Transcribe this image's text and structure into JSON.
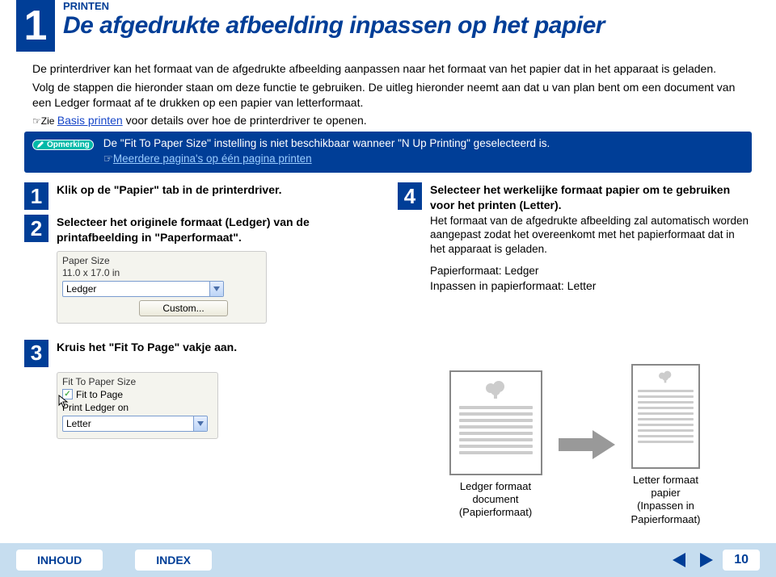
{
  "header": {
    "sectionNumber": "1",
    "printen": "PRINTEN",
    "title": "De afgedrukte afbeelding inpassen op het papier"
  },
  "intro": "De printerdriver kan het formaat van de afgedrukte afbeelding aanpassen naar het formaat van het papier dat in het apparaat is geladen.",
  "intro2": "Volg de stappen die hieronder staan om deze functie te gebruiken. De uitleg hieronder neemt aan dat u van plan bent om een document van een Ledger formaat af te drukken op een papier van letterformaat.",
  "seePrefix": "☞Zie ",
  "seeLink": "Basis printen",
  "seeSuffix": " voor details over hoe de printerdriver te openen.",
  "note": {
    "pill": "Opmerking",
    "line1": "De \"Fit To Paper Size\" instelling is niet beschikbaar wanneer \"N Up Printing\" geselecteerd is.",
    "linkPrefix": "☞",
    "link": "Meerdere pagina's op één pagina printen"
  },
  "steps": {
    "s1": {
      "num": "1",
      "title": "Klik op de \"Papier\" tab in de printerdriver."
    },
    "s2": {
      "num": "2",
      "title": "Selecteer het originele formaat (Ledger) van de printafbeelding in \"Paperformaat\"."
    },
    "s3": {
      "num": "3",
      "title": "Kruis het \"Fit To Page\" vakje aan."
    },
    "s4": {
      "num": "4",
      "title": "Selecteer het werkelijke formaat papier om te gebruiken voor het printen (Letter).",
      "sub": "Het formaat van de afgedrukte afbeelding zal automatisch worden aangepast zodat het overeenkomt met het papierformaat dat in het apparaat is geladen.",
      "extra1": "Papierformaat: Ledger",
      "extra2": "Inpassen in papierformaat: Letter"
    }
  },
  "paperSize": {
    "label": "Paper Size",
    "dims": "11.0 x 17.0 in",
    "value": "Ledger",
    "customBtn": "Custom..."
  },
  "fitToPage": {
    "label": "Fit To Paper Size",
    "checkbox": "Fit to Page",
    "printOn": "Print Ledger on",
    "value": "Letter"
  },
  "illus": {
    "left1": "Ledger formaat",
    "left2": "document",
    "left3": "(Papierformaat)",
    "right1": "Letter formaat",
    "right2": "papier",
    "right3": "(Inpassen in",
    "right4": "Papierformaat)"
  },
  "footer": {
    "inhoud": "INHOUD",
    "index": "INDEX",
    "page": "10"
  }
}
